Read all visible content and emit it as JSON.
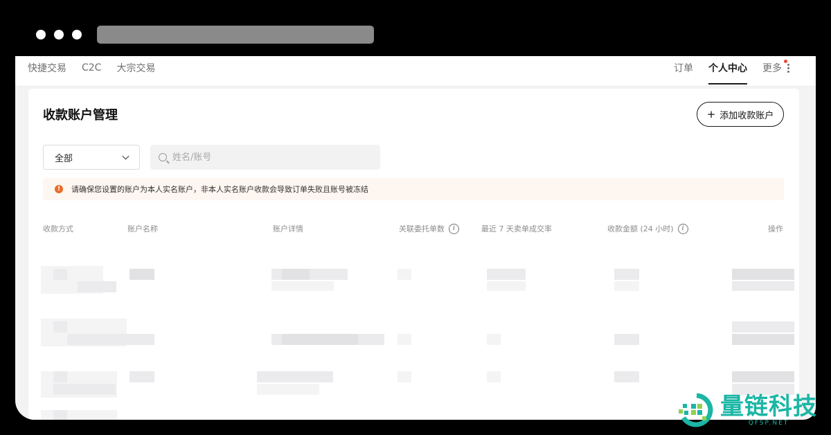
{
  "nav": {
    "left": [
      "快捷交易",
      "C2C",
      "大宗交易"
    ],
    "right": {
      "orders": "订单",
      "profile": "个人中心",
      "more": "更多"
    }
  },
  "page": {
    "title": "收款账户管理",
    "add_button": "添加收款账户"
  },
  "filter": {
    "select_value": "全部",
    "search_placeholder": "姓名/账号"
  },
  "notice": {
    "text": "请确保您设置的账户为本人实名账户，非本人实名账户收款会导致订单失败且账号被冻结"
  },
  "table": {
    "columns": [
      "收款方式",
      "账户名称",
      "账户详情",
      "关联委托单数",
      "最近 7 天卖单成交率",
      "收款金额 (24 小时)",
      "操作"
    ]
  },
  "watermark": {
    "name": "量链科技",
    "domain": "QFSP.NET"
  },
  "colors": {
    "accent": "#1a1a1a",
    "warning": "#e86d2a",
    "notice_bg": "#fdf6f1",
    "logo": "#1bb6a5"
  }
}
